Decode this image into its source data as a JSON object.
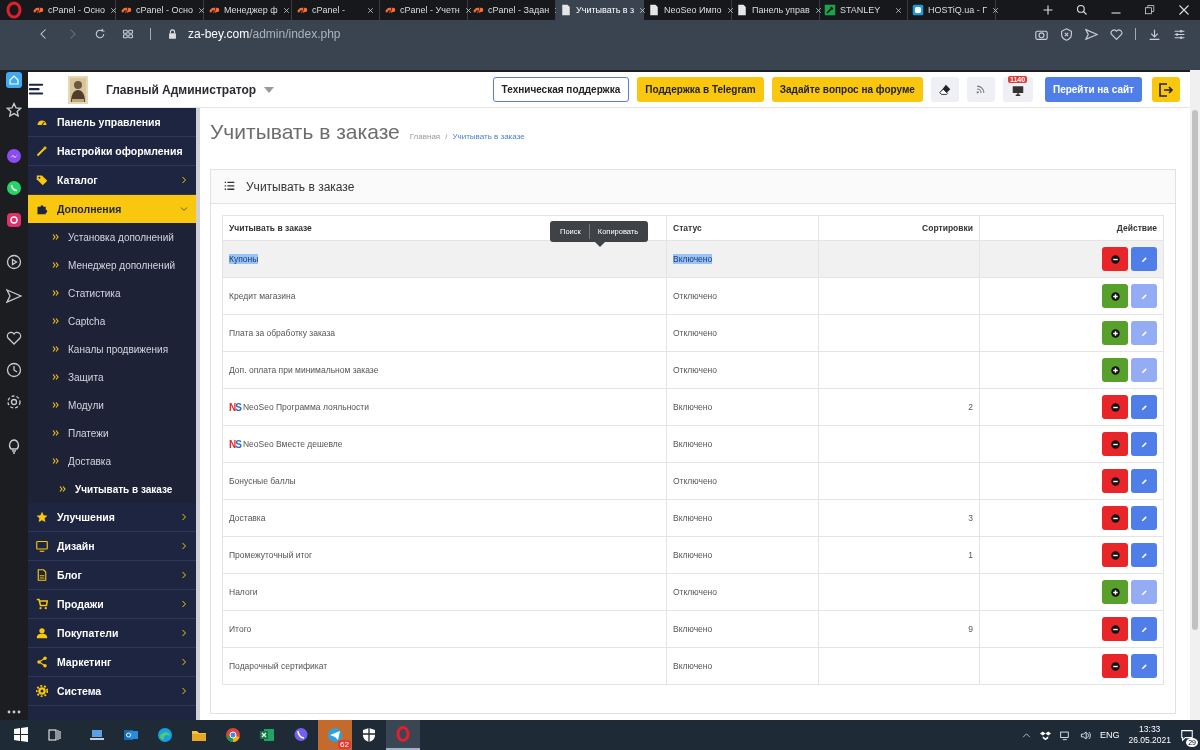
{
  "browser": {
    "tabs": [
      {
        "label": "cPanel - Осно",
        "kind": "cpanel",
        "selected": false
      },
      {
        "label": "cPanel - Осно",
        "kind": "cpanel",
        "selected": false
      },
      {
        "label": "Менеджер ф",
        "kind": "cpanel",
        "selected": false
      },
      {
        "label": "cPanel -",
        "kind": "cpanel",
        "selected": false
      },
      {
        "label": "cPanel - Учетн",
        "kind": "cpanel",
        "selected": false
      },
      {
        "label": "cPanel - Задан",
        "kind": "cpanel",
        "selected": false
      },
      {
        "label": "Учитывать в з",
        "kind": "page",
        "selected": true
      },
      {
        "label": "NeoSeo Импо",
        "kind": "page",
        "selected": false
      },
      {
        "label": "Панель управ",
        "kind": "page",
        "selected": false
      },
      {
        "label": "STANLEY",
        "kind": "stanley",
        "selected": false
      },
      {
        "label": "HOSTiQ.ua - Г",
        "kind": "hostiq",
        "selected": false
      }
    ],
    "address": {
      "domain": "za-bey.com",
      "path": "/admin/index.php"
    }
  },
  "header": {
    "user": "Главный Администратор",
    "buttons": [
      {
        "kind": "outline",
        "label": "Техническая поддержка"
      },
      {
        "kind": "yellow",
        "label": "Поддержка в Telegram"
      },
      {
        "kind": "yellow",
        "label": "Задайте вопрос на форуме"
      },
      {
        "kind": "eraser"
      },
      {
        "kind": "rss"
      },
      {
        "kind": "alerts",
        "badge": "1140"
      },
      {
        "kind": "primary",
        "label": "Перейти на сайт"
      },
      {
        "kind": "logout"
      }
    ]
  },
  "menu": [
    {
      "label": "Панель управления",
      "kind": "link",
      "selected": false
    },
    {
      "label": "Настройки оформления",
      "kind": "link",
      "selected": false
    },
    {
      "label": "Каталог",
      "kind": "group",
      "expanded": false,
      "selected": false
    },
    {
      "label": "Дополнения",
      "kind": "group",
      "expanded": true,
      "selected": true,
      "children": [
        {
          "label": "Установка дополнений",
          "selected": false
        },
        {
          "label": "Менеджер дополнений",
          "selected": false
        },
        {
          "label": "Статистика",
          "selected": false
        },
        {
          "label": "Captcha",
          "selected": false
        },
        {
          "label": "Каналы продвижения",
          "selected": false
        },
        {
          "label": "Защита",
          "selected": false
        },
        {
          "label": "Модули",
          "selected": false
        },
        {
          "label": "Платежи",
          "selected": false
        },
        {
          "label": "Доставка",
          "selected": false,
          "children": [
            {
              "label": "Учитывать в заказе",
              "selected": true
            }
          ]
        }
      ]
    },
    {
      "label": "Улучшения",
      "kind": "group",
      "expanded": false,
      "selected": false
    },
    {
      "label": "Дизайн",
      "kind": "group",
      "expanded": false,
      "selected": false
    },
    {
      "label": "Блог",
      "kind": "group",
      "expanded": false,
      "selected": false
    },
    {
      "label": "Продажи",
      "kind": "group",
      "expanded": false,
      "selected": false
    },
    {
      "label": "Покупатели",
      "kind": "group",
      "expanded": false,
      "selected": false
    },
    {
      "label": "Маркетинг",
      "kind": "group",
      "expanded": false,
      "selected": false
    },
    {
      "label": "Система",
      "kind": "group",
      "expanded": false,
      "selected": false
    }
  ],
  "page": {
    "title": "Учитывать в заказе",
    "breadcrumbs": [
      "Главная",
      "Учитывать в заказе"
    ],
    "breadcrumb_separator": "/",
    "panel_title": "Учитывать в заказе",
    "table": {
      "columns": [
        "Учитывать в заказе",
        "Статус",
        "Сортировки",
        "Действие"
      ],
      "rows": [
        {
          "name": "Купоны",
          "status": "Включено",
          "sort": "",
          "installed": true,
          "selected": true
        },
        {
          "name": "Кредит магазина",
          "status": "Отключено",
          "sort": "",
          "installed": false,
          "selected": false
        },
        {
          "name": "Плата за обработку заказа",
          "status": "Отключено",
          "sort": "",
          "installed": false,
          "selected": false
        },
        {
          "name": "Доп. оплата при минимальном заказе",
          "status": "Отключено",
          "sort": "",
          "installed": false,
          "selected": false
        },
        {
          "logo": "NS",
          "name": "NeoSeo Программа лояльности",
          "status": "Включено",
          "sort": "2",
          "installed": true,
          "selected": false
        },
        {
          "logo": "NS",
          "name": "NeoSeo Вместе дешевле",
          "status": "Включено",
          "sort": "",
          "installed": true,
          "selected": false
        },
        {
          "name": "Бонусные баллы",
          "status": "Отключено",
          "sort": "",
          "installed": true,
          "selected": false
        },
        {
          "name": "Доставка",
          "status": "Включено",
          "sort": "3",
          "installed": true,
          "selected": false
        },
        {
          "name": "Промежуточный итог",
          "status": "Включено",
          "sort": "1",
          "installed": true,
          "selected": false
        },
        {
          "name": "Налоги",
          "status": "Отключено",
          "sort": "",
          "installed": false,
          "selected": false
        },
        {
          "name": "Итого",
          "status": "Включено",
          "sort": "9",
          "installed": true,
          "selected": false
        },
        {
          "name": "Подарочный сертификат",
          "status": "Включено",
          "sort": "",
          "installed": true,
          "selected": false
        }
      ],
      "popup": [
        "Поиск",
        "Копировать"
      ]
    }
  },
  "taskbar": {
    "telegram_badge": "62",
    "language": "ENG",
    "time": "13:33",
    "date": "26.05.2021",
    "notification_count": "29"
  }
}
